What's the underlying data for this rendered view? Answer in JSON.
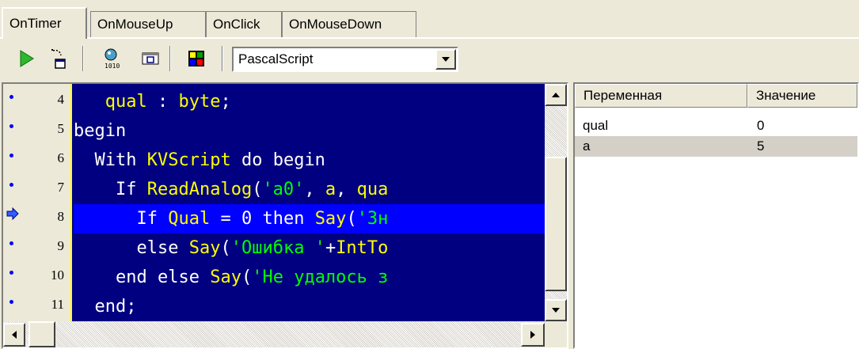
{
  "tabs": [
    {
      "label": "OnTimer",
      "active": true
    },
    {
      "label": "OnMouseUp",
      "active": false
    },
    {
      "label": "OnClick",
      "active": false
    },
    {
      "label": "OnMouseDown",
      "active": false
    }
  ],
  "toolbar": {
    "icons": [
      "run-icon",
      "step-into-icon",
      "watch-icon",
      "breakpoint-icon",
      "color-palette-icon"
    ],
    "language_combo": {
      "value": "PascalScript"
    }
  },
  "editor": {
    "lines": [
      {
        "num": "4",
        "marker": "dot",
        "text": "   qual : byte;"
      },
      {
        "num": "5",
        "marker": "dot",
        "text": "begin"
      },
      {
        "num": "6",
        "marker": "dot",
        "text": "  With KVScript do begin"
      },
      {
        "num": "7",
        "marker": "dot",
        "text": "    If ReadAnalog('a0', a, qua"
      },
      {
        "num": "8",
        "marker": "arrow",
        "text": "      If Qual = 0 then Say('Зн"
      },
      {
        "num": "9",
        "marker": "dot",
        "text": "      else Say('Ошибка '+IntTo"
      },
      {
        "num": "10",
        "marker": "dot",
        "text": "    end else Say('Не удалось з"
      },
      {
        "num": "11",
        "marker": "dot",
        "text": "  end;"
      }
    ],
    "current_line": "8"
  },
  "vars": {
    "headers": [
      "Переменная",
      "Значение"
    ],
    "rows": [
      {
        "name": "qual",
        "value": "0",
        "selected": false
      },
      {
        "name": "a",
        "value": "5",
        "selected": true
      }
    ]
  }
}
